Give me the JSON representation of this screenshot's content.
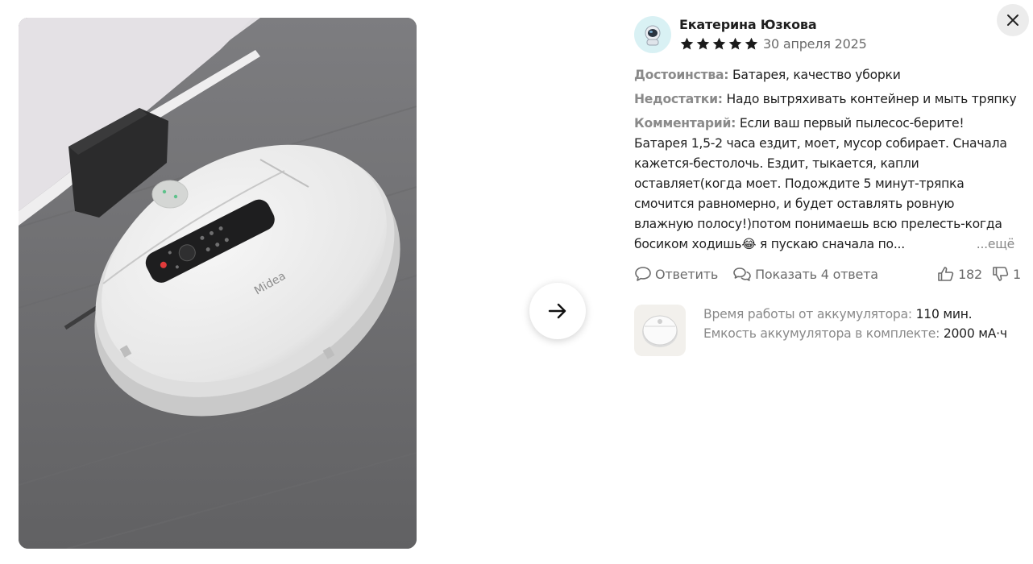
{
  "review": {
    "author": "Екатерина Юзкова",
    "rating": 5,
    "date": "30 апреля 2025",
    "pros_label": "Достоинства:",
    "pros": "Батарея, качество уборки",
    "cons_label": "Недостатки:",
    "cons": "Надо вытряхивать контейнер и мыть тряпку",
    "comment_label": "Комментарий:",
    "comment_lines": [
      "Если ваш первый пылесос-берите!",
      "Батарея 1,5-2 часа ездит, моет, мусор собирает. Сначала",
      "кажется-бестолочь. Ездит, тыкается, капли",
      "оставляет(когда моет. Подождите 5 минут-тряпка",
      "смочится равномерно, и будет оставлять ровную",
      "влажную полосу!)потом понимаешь всю прелесть-когда",
      "босиком ходишь😂 я пускаю сначала по..."
    ],
    "more_label": "...ещё"
  },
  "actions": {
    "reply_label": "Ответить",
    "show_replies_label": "Показать 4 ответа",
    "likes": "182",
    "dislikes": "1"
  },
  "product": {
    "specs": [
      {
        "label": "Время работы от аккумулятора:",
        "value": "110 мин."
      },
      {
        "label": "Емкость аккумулятора в комплекте:",
        "value": "2000 мА·ч"
      }
    ]
  },
  "photo": {
    "brand_text": "Midea"
  },
  "colors": {
    "star": "#1a1a1a",
    "label_gray": "#8a8a8a",
    "avatar_bg": "#d9f1f4"
  },
  "icons": {
    "close": "close-icon",
    "next": "arrow-right-icon",
    "reply": "chat-bubble-icon",
    "show_replies": "chat-bubbles-icon",
    "like": "thumbs-up-icon",
    "dislike": "thumbs-down-icon"
  }
}
